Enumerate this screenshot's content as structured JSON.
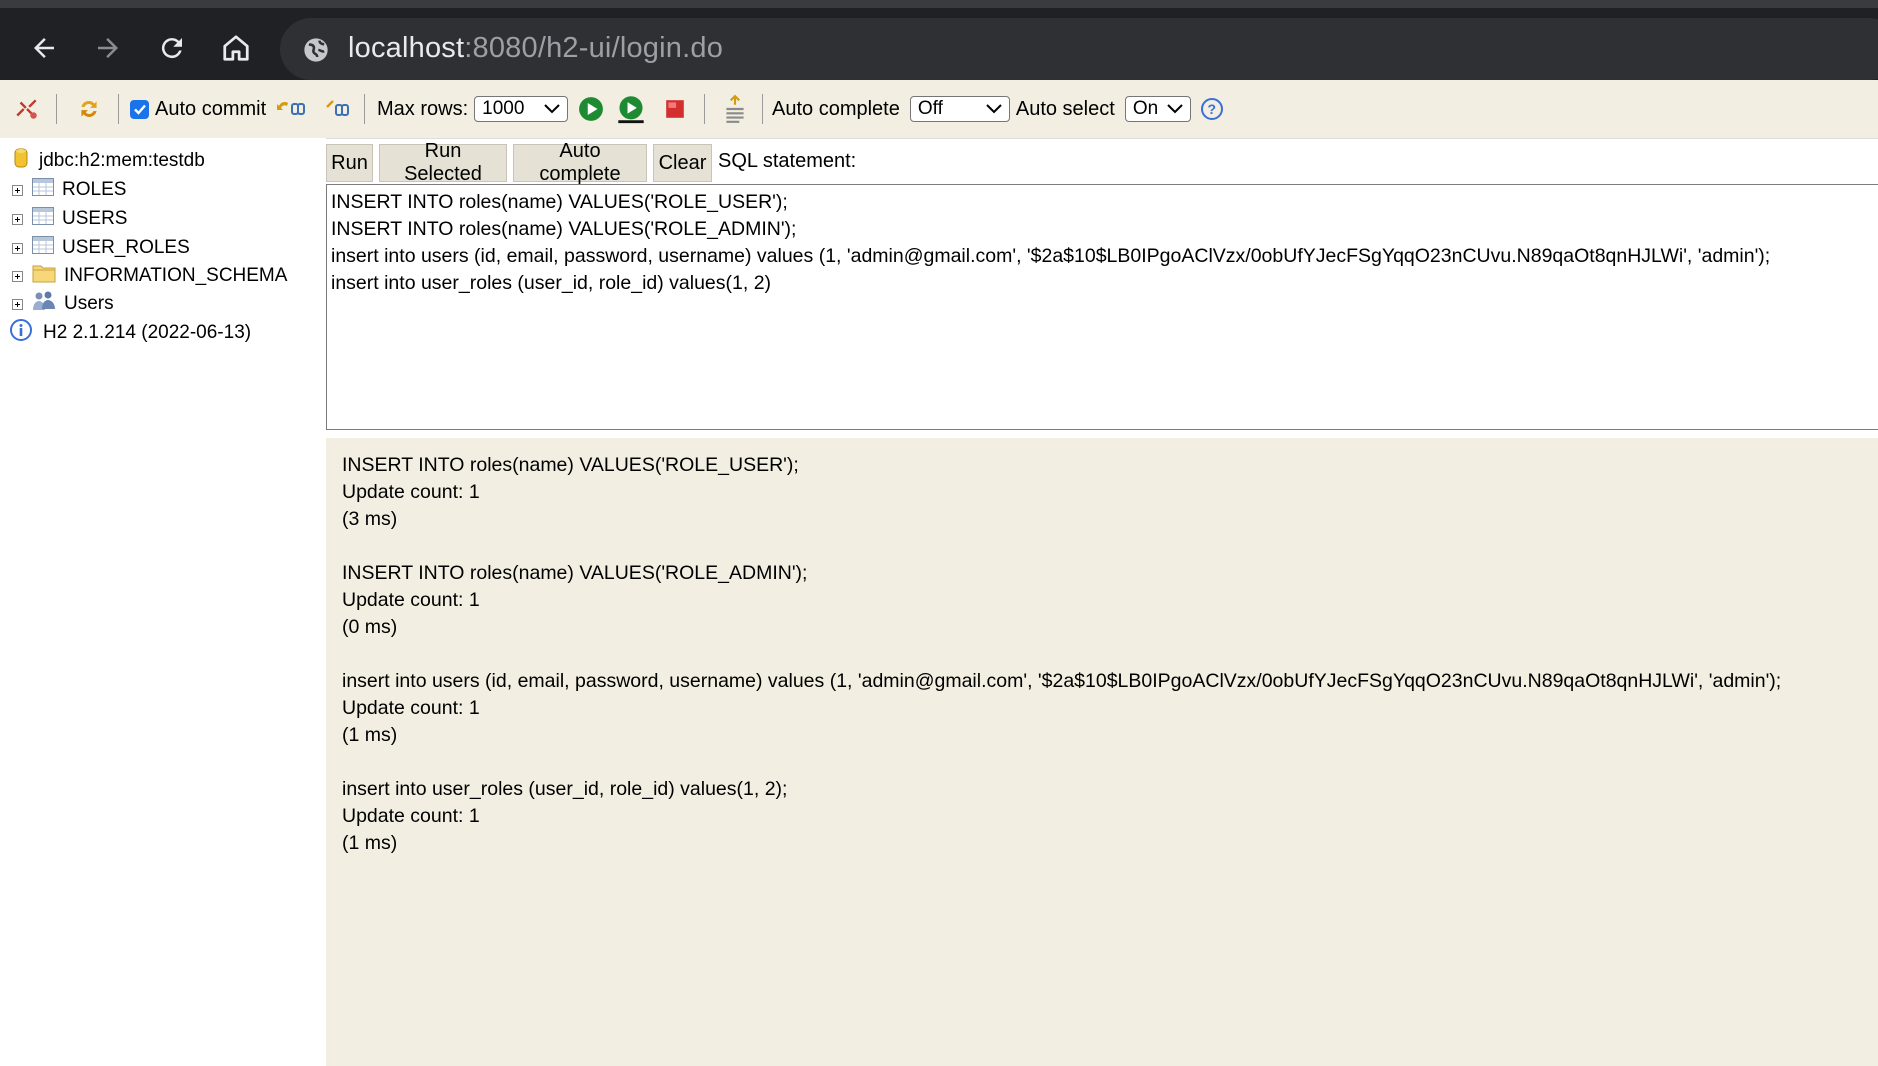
{
  "browser": {
    "url_host": "localhost",
    "url_rest": ":8080/h2-ui/login.do",
    "icons": [
      "back-arrow-icon",
      "forward-arrow-icon",
      "reload-icon",
      "home-icon",
      "globe-icon"
    ]
  },
  "toolbar": {
    "auto_commit_label": "Auto commit",
    "auto_commit_checked": true,
    "max_rows_label": "Max rows:",
    "max_rows_value": "1000",
    "auto_complete_label": "Auto complete",
    "auto_complete_value": "Off",
    "auto_select_label": "Auto select",
    "auto_select_value": "On",
    "help_label": "?"
  },
  "sidebar": {
    "connection": "jdbc:h2:mem:testdb",
    "items": [
      {
        "label": "ROLES",
        "icon": "table-icon"
      },
      {
        "label": "USERS",
        "icon": "table-icon"
      },
      {
        "label": "USER_ROLES",
        "icon": "table-icon"
      },
      {
        "label": "INFORMATION_SCHEMA",
        "icon": "folder-icon"
      },
      {
        "label": "Users",
        "icon": "users-icon"
      }
    ],
    "version": "H2 2.1.214 (2022-06-13)"
  },
  "sql": {
    "run_label": "Run",
    "run_selected_label": "Run Selected",
    "auto_complete_label": "Auto complete",
    "clear_label": "Clear",
    "statement_label": "SQL statement:",
    "editor_lines": [
      "INSERT INTO roles(name) VALUES('ROLE_USER');",
      "INSERT INTO roles(name) VALUES('ROLE_ADMIN');",
      "insert into users (id, email, password, username) values (1, 'admin@gmail.com', '$2a$10$LB0IPgoAClVzx/0obUfYJecFSgYqqO23nCUvu.N89qaOt8qnHJLWi', 'admin');",
      "insert into user_roles (user_id, role_id) values(1, 2)"
    ]
  },
  "results": [
    {
      "statement": "INSERT INTO roles(name) VALUES('ROLE_USER');",
      "count": "Update count: 1",
      "time": "(3 ms)"
    },
    {
      "statement": "INSERT INTO roles(name) VALUES('ROLE_ADMIN');",
      "count": "Update count: 1",
      "time": "(0 ms)"
    },
    {
      "statement": "insert into users (id, email, password, username) values (1, 'admin@gmail.com', '$2a$10$LB0IPgoAClVzx/0obUfYJecFSgYqqO23nCUvu.N89qaOt8qnHJLWi', 'admin');",
      "count": "Update count: 1",
      "time": "(1 ms)"
    },
    {
      "statement": "insert into user_roles (user_id, role_id) values(1, 2);",
      "count": "Update count: 1",
      "time": "(1 ms)"
    }
  ]
}
